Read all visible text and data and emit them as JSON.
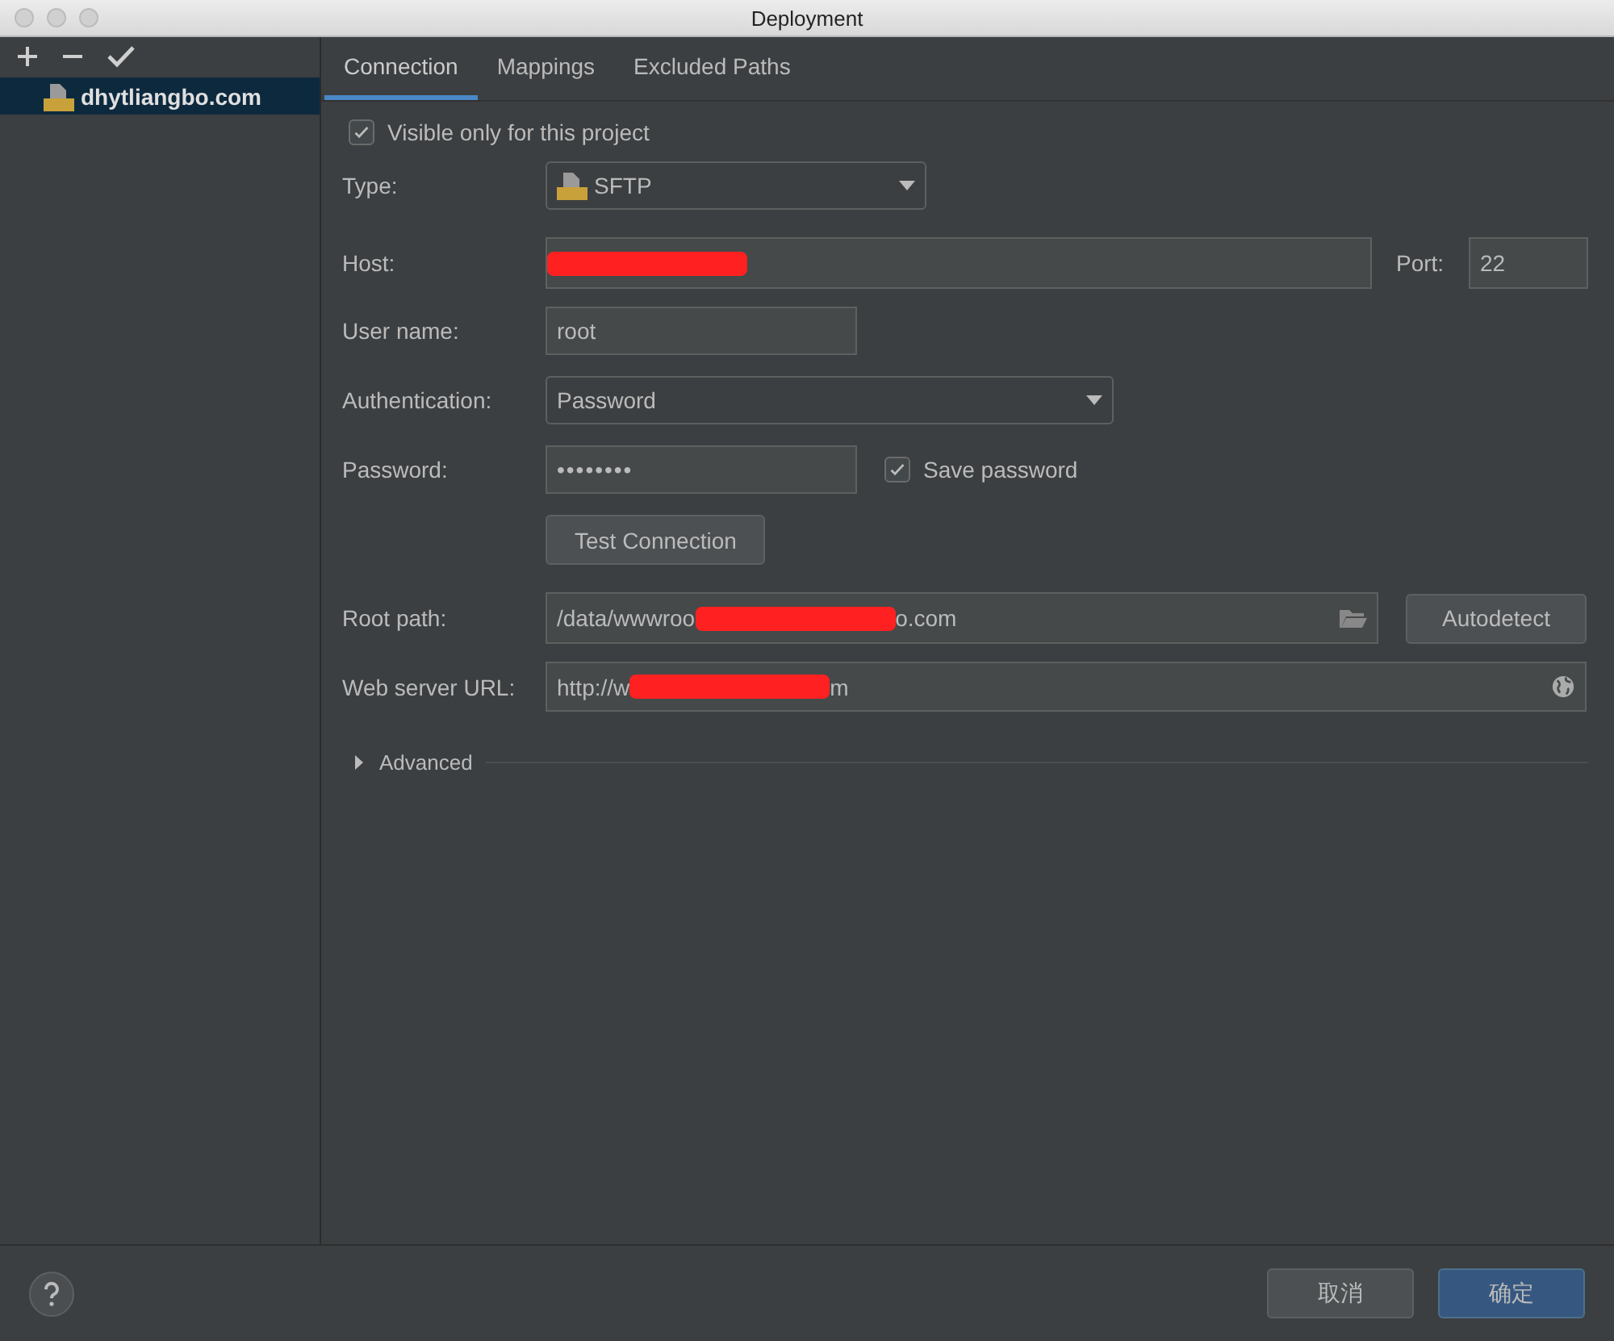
{
  "window": {
    "title": "Deployment"
  },
  "servers": [
    {
      "name": "dhytliangbo.com",
      "selected": true
    }
  ],
  "tabs": [
    {
      "label": "Connection",
      "selected": true
    },
    {
      "label": "Mappings",
      "selected": false
    },
    {
      "label": "Excluded Paths",
      "selected": false
    }
  ],
  "visible_only": {
    "label": "Visible only for this project",
    "checked": true
  },
  "type": {
    "label": "Type:",
    "value": "SFTP"
  },
  "host": {
    "label": "Host:",
    "redacted": true
  },
  "port": {
    "label": "Port:",
    "value": "22"
  },
  "user_name": {
    "label": "User name:",
    "value": "root"
  },
  "authentication": {
    "label": "Authentication:",
    "value": "Password"
  },
  "password": {
    "label": "Password:",
    "value": "••••••••"
  },
  "save_password": {
    "label": "Save password",
    "checked": true
  },
  "test_button": "Test Connection",
  "root_path": {
    "label": "Root path:",
    "value_start": "/data/wwwroo",
    "value_end": "o.com",
    "redacted": true
  },
  "autodetect_button": "Autodetect",
  "web_server_url": {
    "label": "Web server URL:",
    "value_start": "http://w",
    "value_end": "m",
    "redacted": true
  },
  "advanced": {
    "label": "Advanced",
    "expanded": false
  },
  "buttons": [
    {
      "label": "取消",
      "kind": "cancel"
    },
    {
      "label": "确定",
      "kind": "default"
    }
  ]
}
